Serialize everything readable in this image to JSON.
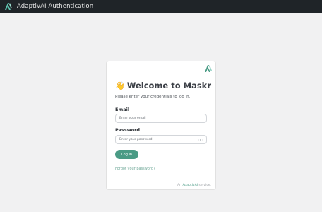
{
  "app": {
    "title": "AdaptivAI Authentication",
    "logo_icon": "adaptivai-logo-icon"
  },
  "card": {
    "wave_emoji": "👋",
    "heading": "Welcome to Maskr",
    "subtitle": "Please enter your credentials to log in.",
    "email": {
      "label": "Email",
      "placeholder": "Enter your email",
      "value": ""
    },
    "password": {
      "label": "Password",
      "placeholder": "Enter your password",
      "value": "",
      "toggle_icon": "eye-icon"
    },
    "login_label": "Log in",
    "forgot_label": "Forgot your password?",
    "footer": {
      "prefix": "An",
      "brand": "AdaptivAI",
      "suffix": "service."
    }
  },
  "colors": {
    "topbar": "#1f2428",
    "accent": "#4a9b85",
    "background": "#f1f1f2",
    "logo_teal": "#5fc4b0"
  }
}
